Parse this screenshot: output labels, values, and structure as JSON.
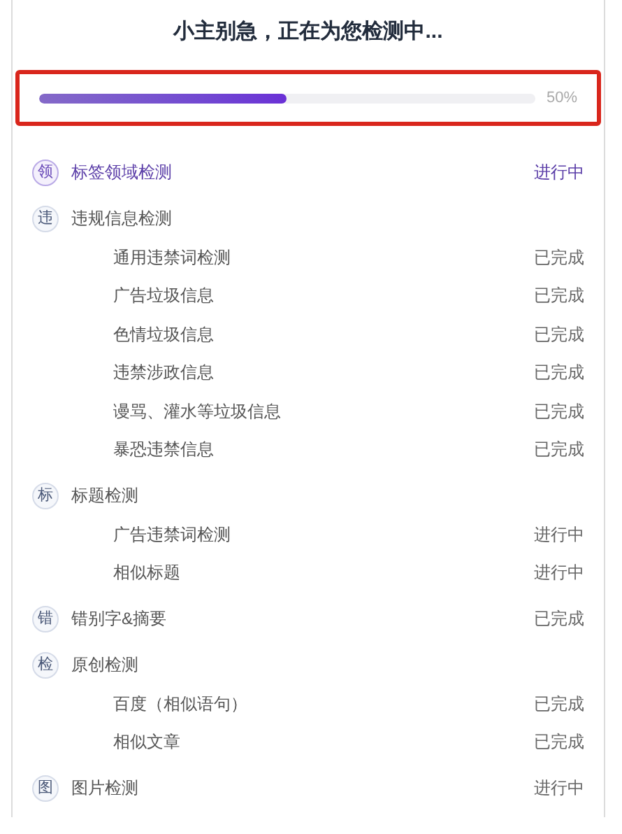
{
  "title": "小主别急，正在为您检测中...",
  "progress": {
    "level": 0.5,
    "reading": "50%"
  },
  "groups": [
    {
      "badge": "领",
      "label": "标签领域检测",
      "status": "进行中",
      "active": true
    },
    {
      "badge": "违",
      "label": "违规信息检测",
      "active": false,
      "children": [
        {
          "label": "通用违禁词检测",
          "status": "已完成"
        },
        {
          "label": "广告垃圾信息",
          "status": "已完成"
        },
        {
          "label": "色情垃圾信息",
          "status": "已完成"
        },
        {
          "label": "违禁涉政信息",
          "status": "已完成"
        },
        {
          "label": "谩骂、灌水等垃圾信息",
          "status": "已完成"
        },
        {
          "label": "暴恐违禁信息",
          "status": "已完成"
        }
      ]
    },
    {
      "badge": "标",
      "label": "标题检测",
      "active": false,
      "children": [
        {
          "label": "广告违禁词检测",
          "status": "进行中"
        },
        {
          "label": "相似标题",
          "status": "进行中"
        }
      ]
    },
    {
      "badge": "错",
      "label": "错别字&摘要",
      "status": "已完成",
      "active": false
    },
    {
      "badge": "检",
      "label": "原创检测",
      "active": false,
      "children": [
        {
          "label": "百度（相似语句）",
          "status": "已完成"
        },
        {
          "label": "相似文章",
          "status": "已完成"
        }
      ]
    },
    {
      "badge": "图",
      "label": "图片检测",
      "status": "进行中",
      "active": false
    }
  ]
}
